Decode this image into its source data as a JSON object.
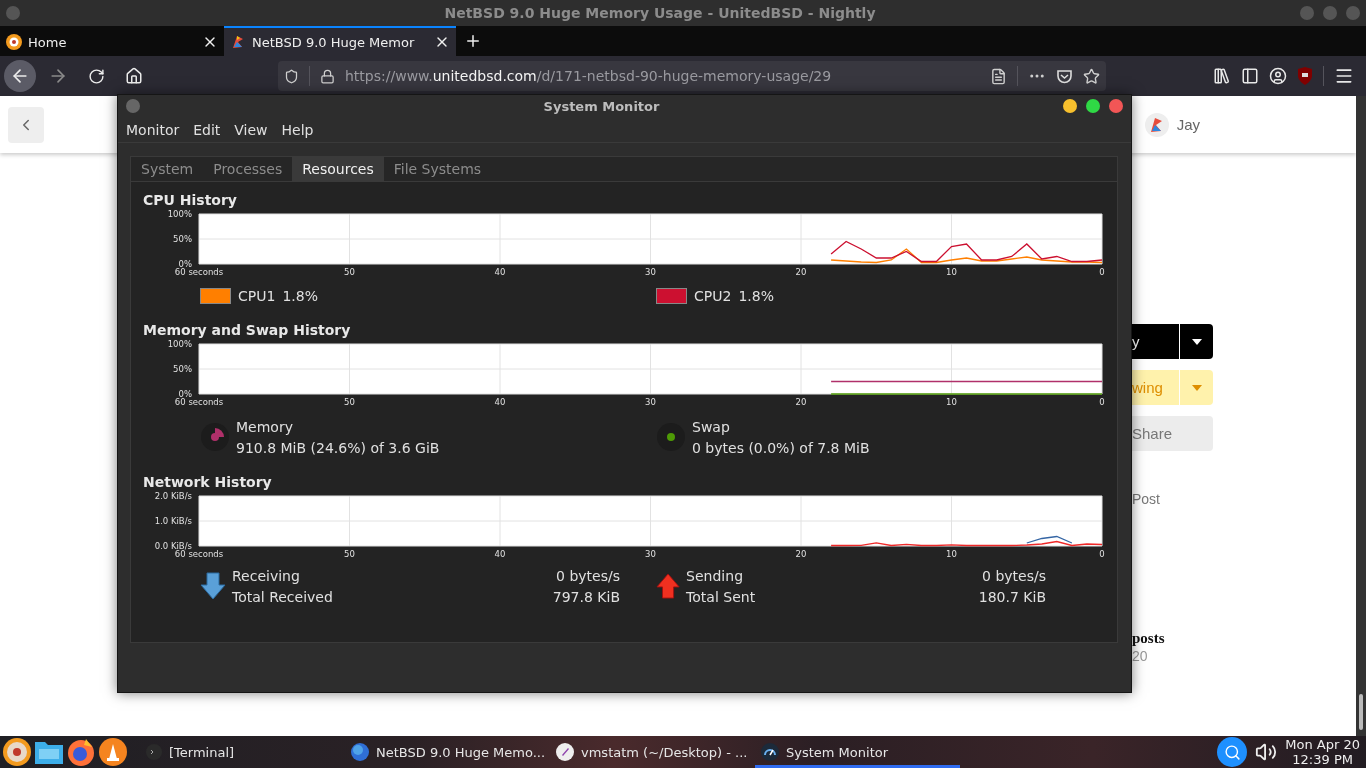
{
  "browser": {
    "title": "NetBSD 9.0 Huge Memory Usage - UnitedBSD - Nightly",
    "tabs": [
      {
        "kind": "home",
        "label": "Home",
        "selected": false
      },
      {
        "kind": "site",
        "label": "NetBSD 9.0 Huge Memor",
        "selected": true
      }
    ],
    "url": {
      "scheme": "https://www.",
      "domain": "unitedbsd.com",
      "path": "/d/171-netbsd-90-huge-memory-usage/29"
    }
  },
  "page": {
    "user": "Jay",
    "actions": [
      {
        "kind": "dark",
        "label": "y"
      },
      {
        "kind": "yellow",
        "label": "wing"
      },
      {
        "kind": "plain",
        "label": "Share"
      }
    ],
    "post_link": "Post",
    "posts_heading": "posts",
    "date_fragment": "20"
  },
  "system_monitor": {
    "title": "System Monitor",
    "menu": [
      "Monitor",
      "Edit",
      "View",
      "Help"
    ],
    "tabs": [
      {
        "label": "System",
        "selected": false
      },
      {
        "label": "Processes",
        "selected": false
      },
      {
        "label": "Resources",
        "selected": true
      },
      {
        "label": "File Systems",
        "selected": false
      }
    ],
    "cpu": {
      "heading": "CPU History",
      "chart_data": {
        "type": "line",
        "grid": true,
        "x": [
          18,
          17,
          16,
          15,
          14,
          13,
          12,
          11,
          10,
          9,
          8,
          7,
          6,
          5,
          4,
          3,
          2,
          1,
          0
        ],
        "xlim": [
          60,
          0
        ],
        "ylim": [
          0,
          100
        ],
        "xticks": [
          {
            "value": 60,
            "label": "60 seconds"
          },
          50,
          40,
          30,
          20,
          10,
          0
        ],
        "yticks": [
          {
            "value": 0,
            "label": "0%"
          },
          {
            "value": 50,
            "label": "50%"
          },
          {
            "value": 100,
            "label": "100%"
          }
        ],
        "series": [
          {
            "name": "CPU1",
            "color": "#ff7f00",
            "values": [
              8,
              6,
              4,
              3,
              8,
              30,
              3,
              3,
              8,
              12,
              6,
              6,
              10,
              14,
              8,
              6,
              4,
              4,
              3
            ]
          },
          {
            "name": "CPU2",
            "color": "#cc1030",
            "values": [
              20,
              45,
              30,
              12,
              12,
              25,
              5,
              5,
              35,
              40,
              8,
              8,
              15,
              40,
              10,
              15,
              5,
              5,
              8
            ]
          }
        ]
      },
      "legend": [
        {
          "value": "1.8%"
        },
        {
          "value": "1.8%"
        }
      ]
    },
    "memory": {
      "heading": "Memory and Swap History",
      "chart_data": {
        "type": "line",
        "grid": true,
        "x": [
          18,
          0
        ],
        "xlim": [
          60,
          0
        ],
        "ylim": [
          0,
          100
        ],
        "xticks": [
          {
            "value": 60,
            "label": "60 seconds"
          },
          50,
          40,
          30,
          20,
          10,
          0
        ],
        "yticks": [
          {
            "value": 0,
            "label": "0%"
          },
          {
            "value": 50,
            "label": "50%"
          },
          {
            "value": 100,
            "label": "100%"
          }
        ],
        "series": [
          {
            "name": "Memory",
            "color": "#b0306a",
            "values": [
              25,
              25
            ]
          },
          {
            "name": "Swap",
            "color": "#4e9a06",
            "values": [
              0,
              0
            ]
          }
        ]
      },
      "items": [
        {
          "kind": "memory",
          "detail": "910.8 MiB (24.6%) of 3.6 GiB"
        },
        {
          "kind": "swap",
          "detail": "0 bytes (0.0%) of 7.8 MiB"
        }
      ]
    },
    "network": {
      "heading": "Network History",
      "chart_data": {
        "type": "line",
        "grid": true,
        "x": [
          18,
          17,
          16,
          15,
          14,
          13,
          12,
          11,
          10,
          9,
          8,
          7,
          6,
          5,
          4,
          3,
          2,
          1,
          0
        ],
        "xlim": [
          60,
          0
        ],
        "ylim": [
          0,
          2
        ],
        "xticks": [
          {
            "value": 60,
            "label": "60 seconds"
          },
          50,
          40,
          30,
          20,
          10,
          0
        ],
        "yticks": [
          {
            "value": 0,
            "label": "0.0 KiB/s"
          },
          {
            "value": 1,
            "label": "1.0 KiB/s"
          },
          {
            "value": 2,
            "label": "2.0 KiB/s"
          }
        ],
        "series": [
          {
            "name": "Receiving",
            "color": "#3465a4",
            "values": [
              null,
              null,
              null,
              null,
              null,
              null,
              null,
              null,
              null,
              null,
              null,
              null,
              null,
              0.12,
              0.3,
              0.38,
              0.12,
              null,
              null
            ]
          },
          {
            "name": "Sending",
            "color": "#ef2929",
            "values": [
              0.02,
              0.02,
              0.03,
              0.13,
              0.02,
              0.07,
              0.02,
              0.02,
              0.05,
              0.02,
              0.02,
              0.02,
              0.02,
              0.04,
              0.08,
              0.18,
              0.02,
              0.08,
              0.06
            ]
          }
        ]
      },
      "items": [
        {
          "kind": "receive",
          "rate": "0 bytes/s",
          "total_label": "Total Received",
          "total": "797.8 KiB"
        },
        {
          "kind": "send",
          "rate": "0 bytes/s",
          "total_label": "Total Sent",
          "total": "180.7 KiB"
        }
      ]
    }
  },
  "taskbar": {
    "items": [
      {
        "kind": "terminal",
        "label": "[Terminal]",
        "selected": false
      },
      {
        "kind": "browser",
        "label": "NetBSD 9.0 Huge Memo...",
        "selected": false
      },
      {
        "kind": "editor",
        "label": "vmstatm (~/Desktop) - ...",
        "selected": false
      },
      {
        "kind": "monitor",
        "label": "System Monitor",
        "selected": true
      }
    ],
    "clock": {
      "date": "Mon Apr 20",
      "time": "12:39 PM"
    }
  }
}
